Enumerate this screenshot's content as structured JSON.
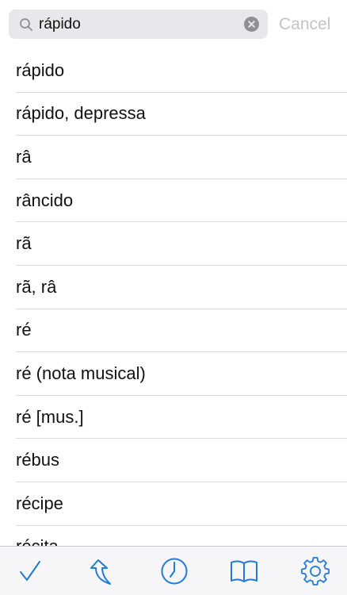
{
  "search": {
    "value": "rápido",
    "cancel_label": "Cancel"
  },
  "results": [
    "rápido",
    "rápido, depressa",
    "râ",
    "râncido",
    "rã",
    "rã, râ",
    "ré",
    "ré (nota musical)",
    "ré [mus.]",
    "rébus",
    "récipe",
    "récita"
  ],
  "toolbar": {
    "items": [
      "checkmark-icon",
      "undo-arrow-icon",
      "clock-icon",
      "book-icon",
      "gear-icon"
    ]
  },
  "colors": {
    "accent": "#1e7bd8",
    "separator": "#d9d9dd",
    "search_field": "#e8e8ec",
    "cancel_text": "#c3c3c8"
  }
}
